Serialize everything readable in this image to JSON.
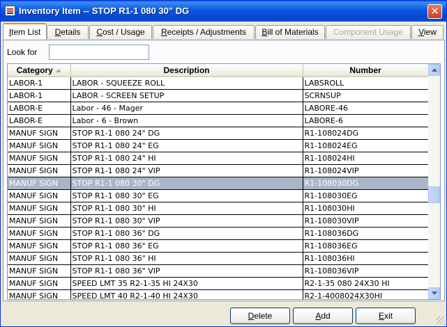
{
  "window": {
    "title": "Inventory Item -- STOP R1-1 080 30\" DG",
    "close_symbol": "✕"
  },
  "tabs": [
    {
      "first": "I",
      "rest": "tem List",
      "active": true,
      "disabled": false
    },
    {
      "first": "D",
      "rest": "etails",
      "active": false,
      "disabled": false
    },
    {
      "first": "C",
      "rest": "ost / Usage",
      "active": false,
      "disabled": false
    },
    {
      "first": "R",
      "rest": "eceipts / Adjustments",
      "active": false,
      "disabled": false
    },
    {
      "first": "B",
      "rest": "ill of Materials",
      "active": false,
      "disabled": false
    },
    {
      "first": "",
      "rest": "Component Usage",
      "active": false,
      "disabled": true
    },
    {
      "first": "V",
      "rest": "iew",
      "active": false,
      "disabled": false
    }
  ],
  "search": {
    "label": "Look for",
    "value": "",
    "placeholder": ""
  },
  "grid": {
    "columns": [
      "Category",
      "Description",
      "Number"
    ],
    "sort_column": "Category",
    "selected_row": 8,
    "rows": [
      [
        "LABOR-1",
        "LABOR - SQUEEZE ROLL",
        "LABSROLL"
      ],
      [
        "LABOR-1",
        "LABOR - SCREEN SETUP",
        "SCRNSUP"
      ],
      [
        "LABOR-E",
        "Labor - 46 - Mager",
        "LABORE-46"
      ],
      [
        "LABOR-E",
        "Labor - 6 - Brown",
        "LABORE-6"
      ],
      [
        "MANUF SIGN",
        "STOP R1-1 080 24\" DG",
        "R1-108024DG"
      ],
      [
        "MANUF SIGN",
        "STOP R1-1 080 24\" EG",
        "R1-108024EG"
      ],
      [
        "MANUF SIGN",
        "STOP R1-1 080 24\" HI",
        "R1-108024HI"
      ],
      [
        "MANUF SIGN",
        "STOP R1-1 080 24\" VIP",
        "R1-108024VIP"
      ],
      [
        "MANUF SIGN",
        "STOP R1-1 080 30\" DG",
        "R1-108030DG"
      ],
      [
        "MANUF SIGN",
        "STOP R1-1 080 30\" EG",
        "R1-108030EG"
      ],
      [
        "MANUF SIGN",
        "STOP R1-1 080 30\" HI",
        "R1-108030HI"
      ],
      [
        "MANUF SIGN",
        "STOP R1-1 080 30\" VIP",
        "R1-108030VIP"
      ],
      [
        "MANUF SIGN",
        "STOP R1-1 080 36\" DG",
        "R1-108036DG"
      ],
      [
        "MANUF SIGN",
        "STOP R1-1 080 36\" EG",
        "R1-108036EG"
      ],
      [
        "MANUF SIGN",
        "STOP R1-1 080 36\" HI",
        "R1-108036HI"
      ],
      [
        "MANUF SIGN",
        "STOP R1-1 080 36\" VIP",
        "R1-108036VIP"
      ],
      [
        "MANUF SIGN",
        "SPEED LMT 35 R2-1-35 HI 24X30",
        "R2-1-35 080 24X30 HI"
      ],
      [
        "MANUF SIGN",
        "SPEED LMT 40 R2-1-40 HI 24X30",
        "R2-1-4008024X30HI"
      ]
    ]
  },
  "buttons": {
    "delete": {
      "first": "D",
      "rest": "elete"
    },
    "add": {
      "first": "A",
      "rest": "dd"
    },
    "exit": {
      "first": "E",
      "rest": "xit"
    }
  },
  "colors": {
    "title_bar": "#0b58e0",
    "selected_row": "#aab5c9",
    "active_tab_accent": "#e68b2c"
  }
}
